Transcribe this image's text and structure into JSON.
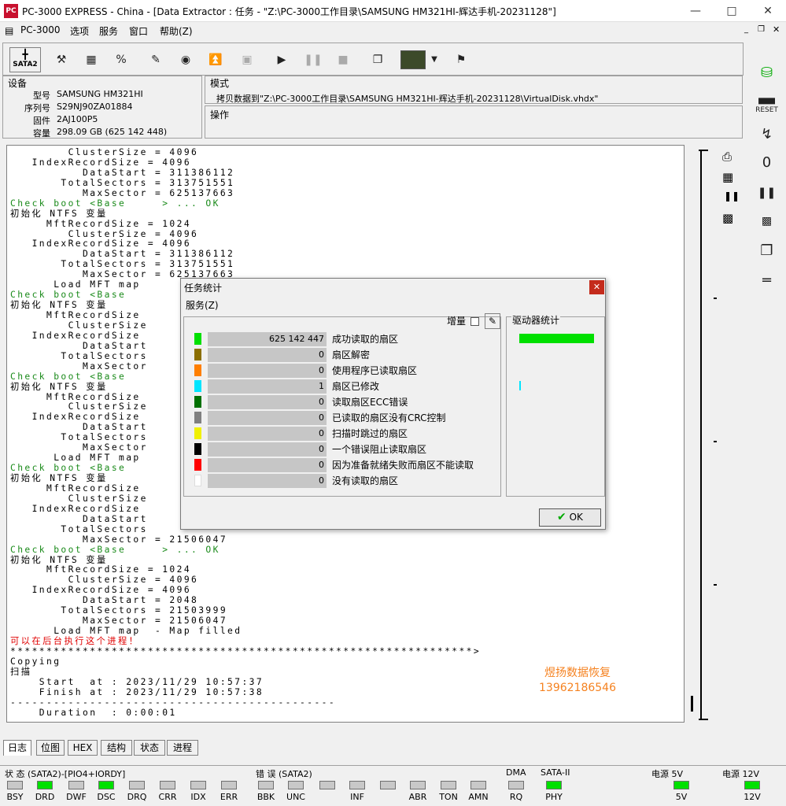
{
  "window": {
    "title": "PC-3000 EXPRESS - China - [Data Extractor : 任务 - \"Z:\\PC-3000工作目录\\SAMSUNG HM321HI-辉达手机-20231128\"]",
    "app_icon": "PC"
  },
  "menu": {
    "app": "PC-3000",
    "items": [
      "选项",
      "服务",
      "窗口",
      "帮助(Z)"
    ]
  },
  "toolbar": {
    "sata_label": "SATA2"
  },
  "device": {
    "title": "设备",
    "rows": [
      {
        "label": "型号",
        "value": "SAMSUNG HM321HI"
      },
      {
        "label": "序列号",
        "value": "S29NJ90ZA01884"
      },
      {
        "label": "固件",
        "value": "2AJ100P5"
      },
      {
        "label": "容量",
        "value": "298.09 GB (625 142 448)"
      }
    ]
  },
  "mode": {
    "title": "模式",
    "text": "拷贝数据到\"Z:\\PC-3000工作目录\\SAMSUNG HM321HI-辉达手机-20231128\\VirtualDisk.vhdx\""
  },
  "operation": {
    "title": "操作"
  },
  "log": {
    "lines": [
      {
        "t": "        ClusterSize = 4096",
        "c": ""
      },
      {
        "t": "   IndexRecordSize = 4096",
        "c": ""
      },
      {
        "t": "          DataStart = 311386112",
        "c": ""
      },
      {
        "t": "       TotalSectors = 313751551",
        "c": ""
      },
      {
        "t": "          MaxSector = 625137663",
        "c": ""
      },
      {
        "t": "Check boot <Base     > ... OK",
        "c": "g"
      },
      {
        "t": "初始化 NTFS 变量",
        "c": ""
      },
      {
        "t": "     MftRecordSize = 1024",
        "c": ""
      },
      {
        "t": "        ClusterSize = 4096",
        "c": ""
      },
      {
        "t": "   IndexRecordSize = 4096",
        "c": ""
      },
      {
        "t": "          DataStart = 311386112",
        "c": ""
      },
      {
        "t": "       TotalSectors = 313751551",
        "c": ""
      },
      {
        "t": "          MaxSector = 625137663",
        "c": ""
      },
      {
        "t": "      Load MFT map",
        "c": ""
      },
      {
        "t": "Check boot <Base",
        "c": "g"
      },
      {
        "t": "初始化 NTFS 变量",
        "c": ""
      },
      {
        "t": "     MftRecordSize",
        "c": ""
      },
      {
        "t": "        ClusterSize",
        "c": ""
      },
      {
        "t": "   IndexRecordSize",
        "c": ""
      },
      {
        "t": "          DataStart",
        "c": ""
      },
      {
        "t": "       TotalSectors",
        "c": ""
      },
      {
        "t": "          MaxSector",
        "c": ""
      },
      {
        "t": "Check boot <Base",
        "c": "g"
      },
      {
        "t": "初始化 NTFS 变量",
        "c": ""
      },
      {
        "t": "     MftRecordSize",
        "c": ""
      },
      {
        "t": "        ClusterSize",
        "c": ""
      },
      {
        "t": "   IndexRecordSize",
        "c": ""
      },
      {
        "t": "          DataStart",
        "c": ""
      },
      {
        "t": "       TotalSectors",
        "c": ""
      },
      {
        "t": "          MaxSector",
        "c": ""
      },
      {
        "t": "      Load MFT map",
        "c": ""
      },
      {
        "t": "Check boot <Base",
        "c": "g"
      },
      {
        "t": "初始化 NTFS 变量",
        "c": ""
      },
      {
        "t": "     MftRecordSize",
        "c": ""
      },
      {
        "t": "        ClusterSize",
        "c": ""
      },
      {
        "t": "   IndexRecordSize",
        "c": ""
      },
      {
        "t": "          DataStart",
        "c": ""
      },
      {
        "t": "       TotalSectors",
        "c": ""
      },
      {
        "t": "          MaxSector = 21506047",
        "c": ""
      },
      {
        "t": "Check boot <Base     > ... OK",
        "c": "g"
      },
      {
        "t": "初始化 NTFS 变量",
        "c": ""
      },
      {
        "t": "     MftRecordSize = 1024",
        "c": ""
      },
      {
        "t": "        ClusterSize = 4096",
        "c": ""
      },
      {
        "t": "   IndexRecordSize = 4096",
        "c": ""
      },
      {
        "t": "          DataStart = 2048",
        "c": ""
      },
      {
        "t": "       TotalSectors = 21503999",
        "c": ""
      },
      {
        "t": "          MaxSector = 21506047",
        "c": ""
      },
      {
        "t": "      Load MFT map  - Map filled",
        "c": ""
      },
      {
        "t": "可以在后台执行这个进程！",
        "c": "r"
      },
      {
        "t": "****************************************************************>",
        "c": ""
      },
      {
        "t": "Copying",
        "c": ""
      },
      {
        "t": "扫描",
        "c": ""
      },
      {
        "t": "    Start  at : 2023/11/29 10:57:37",
        "c": ""
      },
      {
        "t": "    Finish at : 2023/11/29 10:57:38",
        "c": ""
      },
      {
        "t": "---------------------------------------------",
        "c": ""
      },
      {
        "t": "    Duration  : 0:00:01",
        "c": ""
      }
    ]
  },
  "watermark": {
    "line1": "煜扬数据恢复",
    "line2": "13962186546"
  },
  "tabs": [
    "日志",
    "位图",
    "HEX",
    "结构",
    "状态",
    "进程"
  ],
  "status": {
    "group1_title": "状 态 (SATA2)-[PIO4+IORDY]",
    "group1": [
      {
        "l": "BSY",
        "on": false
      },
      {
        "l": "DRD",
        "on": true
      },
      {
        "l": "DWF",
        "on": false
      },
      {
        "l": "DSC",
        "on": true
      },
      {
        "l": "DRQ",
        "on": false
      },
      {
        "l": "CRR",
        "on": false
      },
      {
        "l": "IDX",
        "on": false
      },
      {
        "l": "ERR",
        "on": false
      }
    ],
    "group2_title": "错 误 (SATA2)",
    "group2": [
      {
        "l": "BBK",
        "on": false
      },
      {
        "l": "UNC",
        "on": false
      },
      {
        "l": "",
        "on": false
      },
      {
        "l": "INF",
        "on": false
      },
      {
        "l": "",
        "on": false
      },
      {
        "l": "ABR",
        "on": false
      },
      {
        "l": "TON",
        "on": false
      },
      {
        "l": "AMN",
        "on": false
      }
    ],
    "dma_title": "DMA",
    "dma": {
      "l": "RQ",
      "on": false
    },
    "sata_title": "SATA-II",
    "sata": {
      "l": "PHY",
      "on": true
    },
    "p5_title": "电源 5V",
    "p5": {
      "l": "5V",
      "on": true
    },
    "p12_title": "电源 12V",
    "p12": {
      "l": "12V",
      "on": true
    }
  },
  "dialog": {
    "title": "任务统计",
    "menu": "服务(Z)",
    "incr": "增量",
    "drive_title": "驱动器统计",
    "ok": "OK",
    "counters": [
      {
        "v": "625 142 447",
        "l": "成功读取的扇区",
        "c": "#00e000"
      },
      {
        "v": "0",
        "l": "扇区解密",
        "c": "#8b6f00"
      },
      {
        "v": "0",
        "l": "使用程序已读取扇区",
        "c": "#ff7f00"
      },
      {
        "v": "1",
        "l": "扇区已修改",
        "c": "#00e5ff"
      },
      {
        "v": "0",
        "l": "读取扇区ECC错误",
        "c": "#007000"
      },
      {
        "v": "0",
        "l": "已读取的扇区没有CRC控制",
        "c": "#808080"
      },
      {
        "v": "0",
        "l": "扫描时跳过的扇区",
        "c": "#f0f000"
      },
      {
        "v": "0",
        "l": "一个错误阻止读取扇区",
        "c": "#000000"
      },
      {
        "v": "0",
        "l": "因为准备就绪失败而扇区不能读取",
        "c": "#ff0000"
      },
      {
        "v": "0",
        "l": "没有读取的扇区",
        "c": "#ffffff"
      }
    ]
  }
}
